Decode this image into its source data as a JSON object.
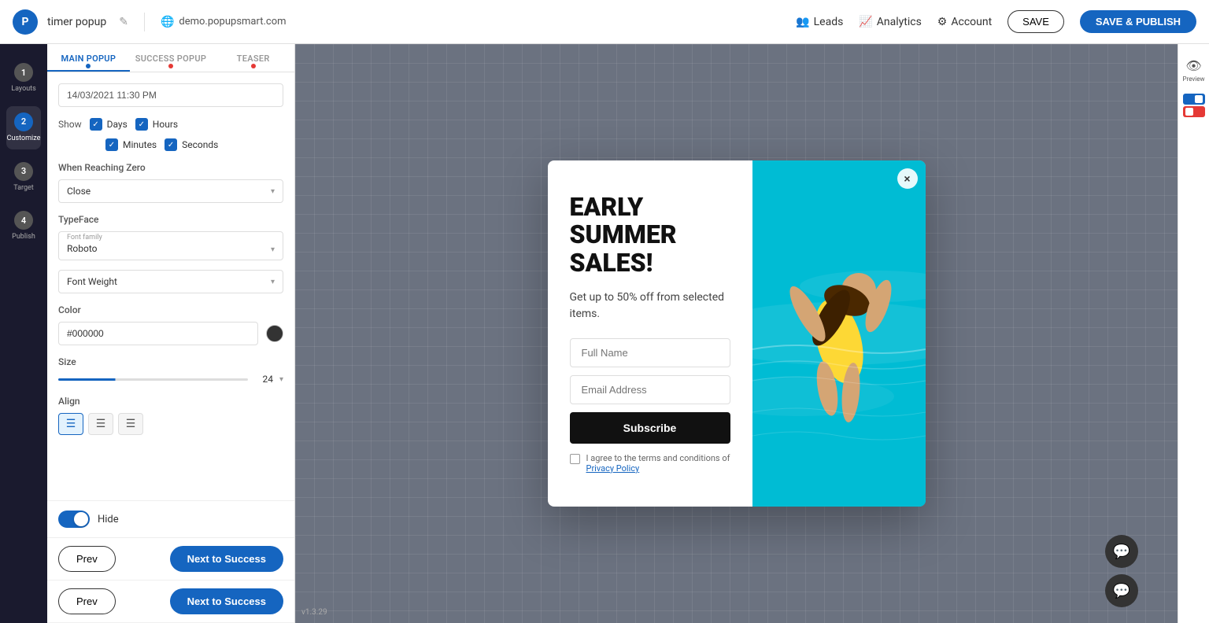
{
  "topnav": {
    "logo_text": "P",
    "app_name": "timer popup",
    "edit_icon": "✎",
    "url_icon": "🌐",
    "url": "demo.popupsmart.com",
    "leads_label": "Leads",
    "analytics_label": "Analytics",
    "account_label": "Account",
    "save_label": "SAVE",
    "save_publish_label": "SAVE & PUBLISH",
    "leads_icon": "👥",
    "analytics_icon": "📈",
    "account_icon": "⚙"
  },
  "step_sidebar": {
    "steps": [
      {
        "num": "1",
        "label": "Layouts",
        "active": false
      },
      {
        "num": "2",
        "label": "Customize",
        "active": true
      },
      {
        "num": "3",
        "label": "Target",
        "active": false
      },
      {
        "num": "4",
        "label": "Publish",
        "active": false
      }
    ]
  },
  "panel": {
    "tabs": [
      {
        "label": "MAIN POPUP",
        "active": true
      },
      {
        "label": "SUCCESS POPUP",
        "active": false
      },
      {
        "label": "TEASER",
        "active": false
      }
    ],
    "datetime_value": "14/03/2021 11:30 PM",
    "show_label": "Show",
    "show_items": [
      {
        "label": "Days",
        "checked": true
      },
      {
        "label": "Hours",
        "checked": true
      },
      {
        "label": "Minutes",
        "checked": true
      },
      {
        "label": "Seconds",
        "checked": true
      }
    ],
    "when_reaching_zero_label": "When Reaching Zero",
    "when_reaching_zero_value": "Close",
    "typeface_label": "TypeFace",
    "font_family_sublabel": "Font family",
    "font_family_value": "Roboto",
    "font_weight_label": "Font Weight",
    "color_label": "Color",
    "color_value": "#000000",
    "size_label": "Size",
    "size_value": "24",
    "align_label": "Align",
    "align_options": [
      "left",
      "center",
      "right"
    ],
    "hide_label": "Hide",
    "hide_toggle": true
  },
  "footer": {
    "rows": [
      {
        "prev_label": "Prev",
        "next_label": "Next to Success"
      },
      {
        "prev_label": "Prev",
        "next_label": "Next to Success"
      }
    ]
  },
  "popup": {
    "title": "EARLY SUMMER SALES!",
    "subtitle": "Get up to 50% off from selected items.",
    "full_name_placeholder": "Full Name",
    "email_placeholder": "Email Address",
    "subscribe_label": "Subscribe",
    "terms_text": "I agree to the terms and conditions of",
    "terms_link": "Privacy Policy",
    "close_icon": "×"
  },
  "right_sidebar": {
    "preview_label": "Preview",
    "preview_icon": "👁"
  },
  "version": "v1.3.29"
}
